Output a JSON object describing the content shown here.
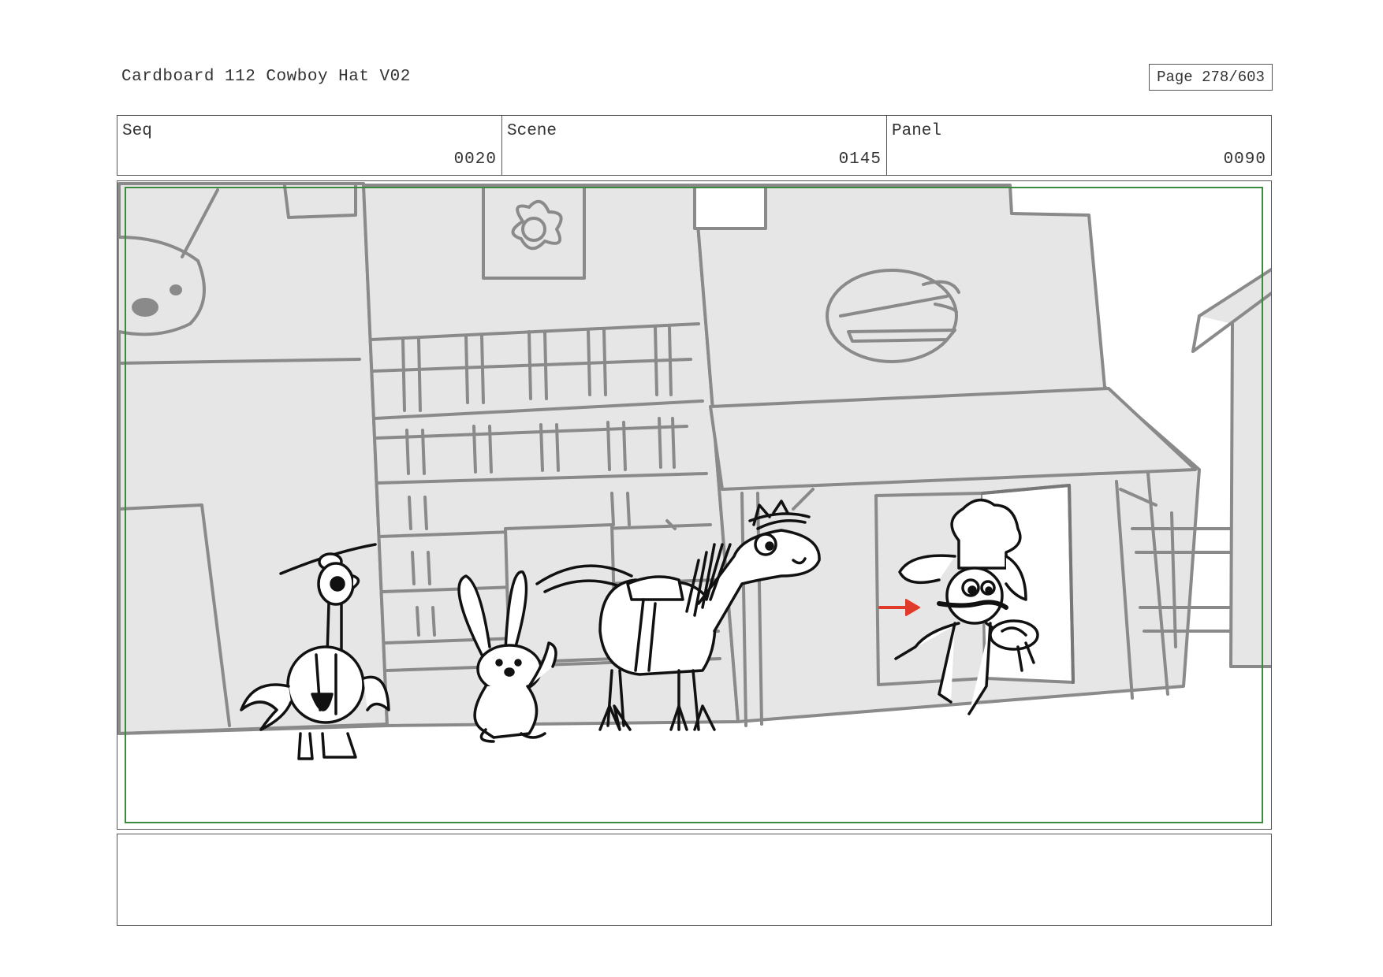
{
  "document": {
    "title": "Cardboard 112 Cowboy Hat V02",
    "page": "Page 278/603"
  },
  "info": {
    "seq_label": "Seq",
    "seq_value": "0020",
    "scene_label": "Scene",
    "scene_value": "0145",
    "panel_label": "Panel",
    "panel_value": "0090"
  },
  "notes": {
    "text": ""
  },
  "colors": {
    "safe_frame": "#3c8a3c",
    "arrow": "#e03a2a",
    "building_fill": "#e6e6e6",
    "building_line": "#8a8a8a"
  }
}
